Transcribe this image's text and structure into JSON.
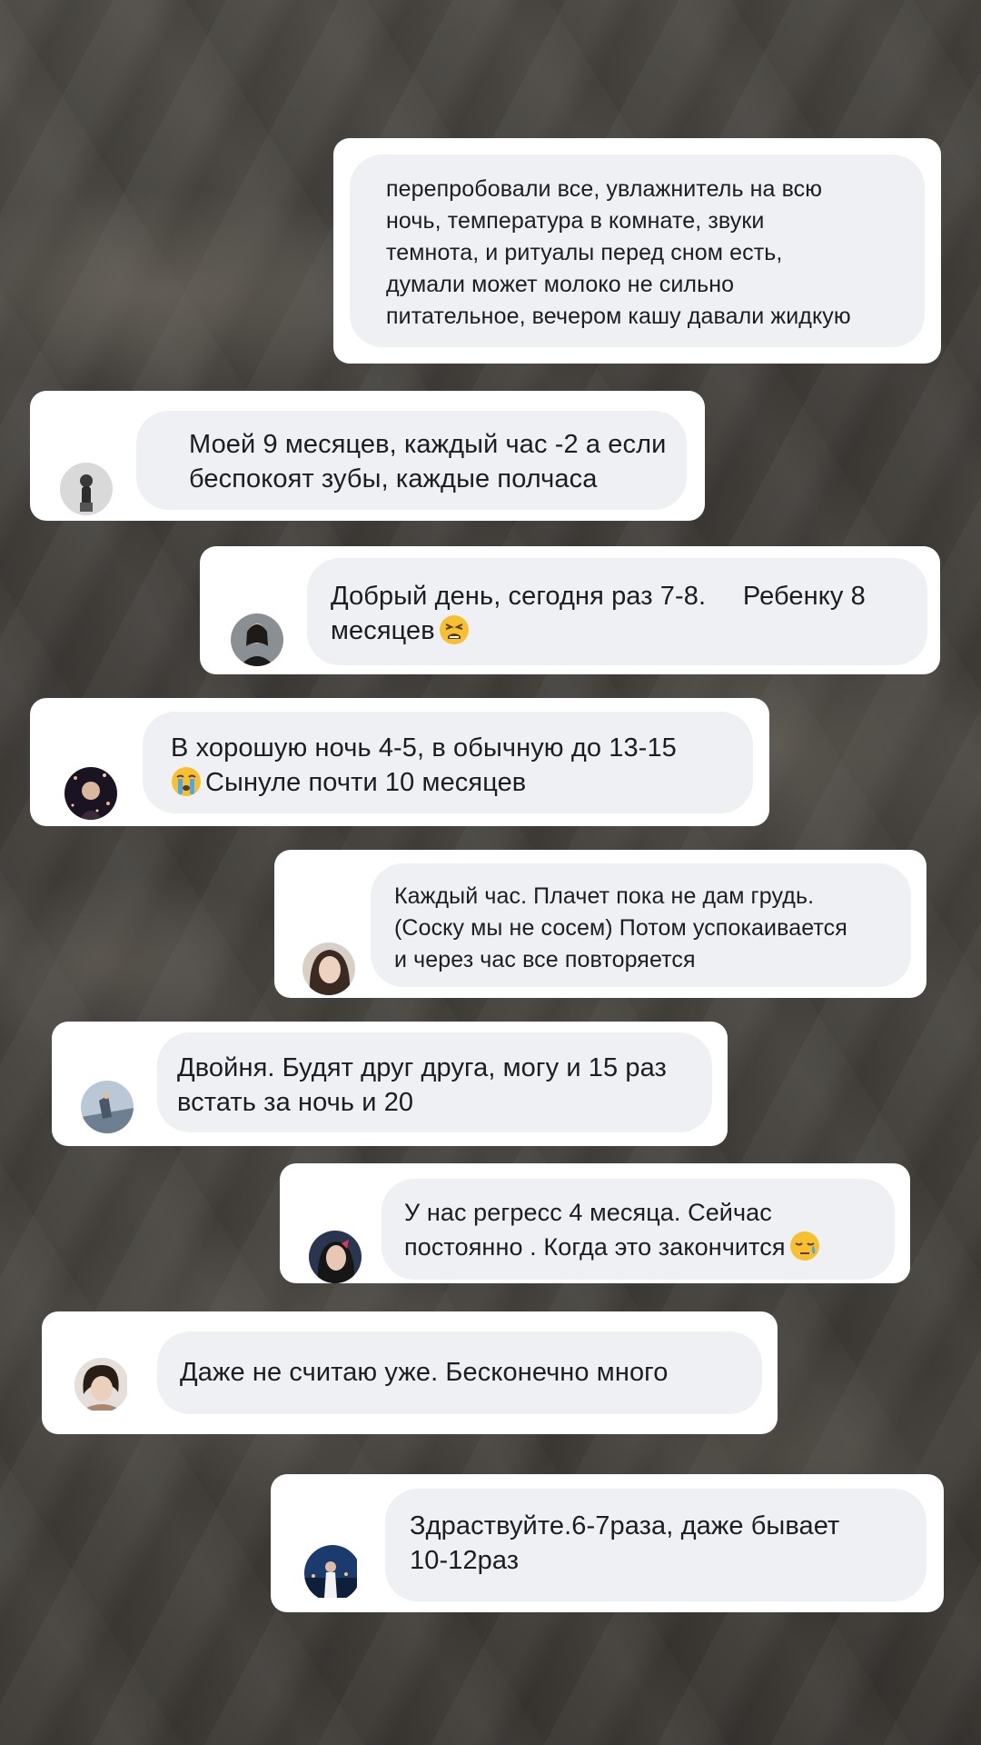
{
  "messages": [
    {
      "text": "перепробовали все, увлажнитель на всю\nночь, температура в комнате, звуки\nтемнота, и ритуалы перед сном есть,\nдумали может молоко не сильно\nпитательное, вечером кашу давали жидкую",
      "avatar_icon": "none"
    },
    {
      "text": "Моей 9 месяцев, каждый час -2 а если\nбеспокоят зубы, каждые полчаса",
      "avatar_icon": "user-avatar-icon"
    },
    {
      "text": "Добрый день, сегодня раз 7-8.     Ребенку 8\nмесяцев",
      "emoji_after": "tired-face-emoji",
      "avatar_icon": "user-avatar-icon"
    },
    {
      "text_before_emoji": "В хорошую ночь 4-5, в обычную до 13-15\n",
      "emoji": "crying-face-emoji",
      "text_after_emoji": "Сынуле почти 10 месяцев",
      "avatar_icon": "user-avatar-icon"
    },
    {
      "text": "Каждый час. Плачет пока не дам грудь.\n(Соску мы не сосем) Потом успокаивается\nи через час все повторяется",
      "avatar_icon": "user-avatar-icon"
    },
    {
      "text": "Двойня. Будят друг друга, могу и 15 раз\nвстать за ночь и 20",
      "avatar_icon": "user-avatar-icon"
    },
    {
      "text": "У нас регресс 4 месяца. Сейчас\nпостоянно . Когда это закончится",
      "emoji_after": "sleepy-face-emoji",
      "avatar_icon": "user-avatar-icon"
    },
    {
      "text": "Даже не считаю уже. Бесконечно много",
      "avatar_icon": "user-avatar-icon"
    },
    {
      "text": "Здраствуйте.6-7раза, даже бывает\n10-12раз",
      "avatar_icon": "user-avatar-icon"
    }
  ],
  "colors": {
    "card": "#ffffff",
    "bubble": "#eef0f3",
    "text": "#1d1d1f",
    "emoji_yellow": "#f7c030"
  }
}
